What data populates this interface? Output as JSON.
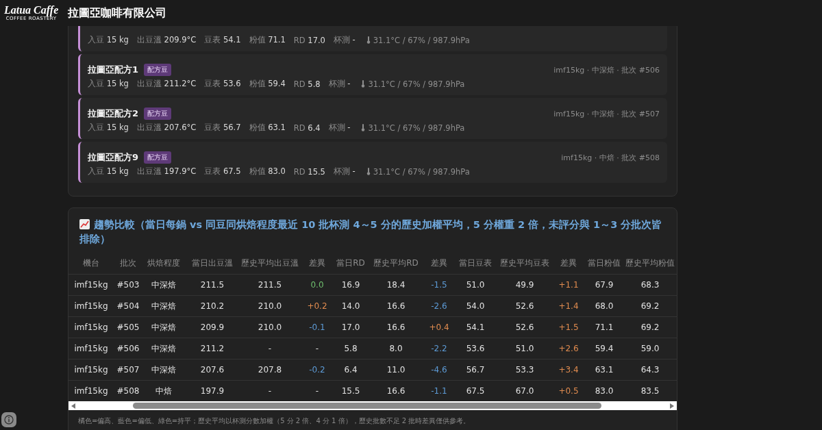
{
  "header": {
    "logo": "Latua Caffe",
    "logo_sub": "COFFEE ROASTERY",
    "title": "拉圖亞咖啡有限公司"
  },
  "batches": [
    {
      "stats": [
        {
          "label": "入豆",
          "value": "15 kg"
        },
        {
          "label": "出豆溫",
          "value": "209.9°C"
        },
        {
          "label": "豆表",
          "value": "54.1"
        },
        {
          "label": "粉值",
          "value": "71.1"
        },
        {
          "label": "RD",
          "value": "17.0"
        },
        {
          "label": "杯測",
          "value": "-"
        }
      ],
      "weather": "31.1°C / 67% / 987.9hPa"
    },
    {
      "name": "拉圖亞配方1",
      "tag": "配方豆",
      "meta": "imf15kg · 中深焙 · 批次 #506",
      "stats": [
        {
          "label": "入豆",
          "value": "15 kg"
        },
        {
          "label": "出豆溫",
          "value": "211.2°C"
        },
        {
          "label": "豆表",
          "value": "53.6"
        },
        {
          "label": "粉值",
          "value": "59.4"
        },
        {
          "label": "RD",
          "value": "5.8"
        },
        {
          "label": "杯測",
          "value": "-"
        }
      ],
      "weather": "31.1°C / 67% / 987.9hPa"
    },
    {
      "name": "拉圖亞配方2",
      "tag": "配方豆",
      "meta": "imf15kg · 中深焙 · 批次 #507",
      "stats": [
        {
          "label": "入豆",
          "value": "15 kg"
        },
        {
          "label": "出豆溫",
          "value": "207.6°C"
        },
        {
          "label": "豆表",
          "value": "56.7"
        },
        {
          "label": "粉值",
          "value": "63.1"
        },
        {
          "label": "RD",
          "value": "6.4"
        },
        {
          "label": "杯測",
          "value": "-"
        }
      ],
      "weather": "31.1°C / 67% / 987.9hPa"
    },
    {
      "name": "拉圖亞配方9",
      "tag": "配方豆",
      "meta": "imf15kg · 中焙 · 批次 #508",
      "stats": [
        {
          "label": "入豆",
          "value": "15 kg"
        },
        {
          "label": "出豆溫",
          "value": "197.9°C"
        },
        {
          "label": "豆表",
          "value": "67.5"
        },
        {
          "label": "粉值",
          "value": "83.0"
        },
        {
          "label": "RD",
          "value": "15.5"
        },
        {
          "label": "杯測",
          "value": "-"
        }
      ],
      "weather": "31.1°C / 67% / 987.9hPa"
    }
  ],
  "trend": {
    "title": "趨勢比較（當日每鍋 vs 同豆同烘焙程度最近 10 批杯測 4～5 分的歷史加權平均，5 分權重 2 倍，未評分與 1～3 分批次皆排除）",
    "columns": [
      "機台",
      "批次",
      "烘焙程度",
      "當日出豆溫",
      "歷史平均出豆溫",
      "差異",
      "當日RD",
      "歷史平均RD",
      "差異",
      "當日豆表",
      "歷史平均豆表",
      "差異",
      "當日粉值",
      "歷史平均粉值"
    ],
    "rows": [
      [
        {
          "text": "imf15kg"
        },
        {
          "text": "#503"
        },
        {
          "text": "中深焙"
        },
        {
          "text": "211.5"
        },
        {
          "text": "211.5"
        },
        {
          "text": "0.0",
          "color": "#6fbf6e"
        },
        {
          "text": "16.9"
        },
        {
          "text": "18.4"
        },
        {
          "text": "-1.5",
          "color": "#5d9bd6"
        },
        {
          "text": "51.0"
        },
        {
          "text": "49.9"
        },
        {
          "text": "+1.1",
          "color": "#e08b4f"
        },
        {
          "text": "67.9"
        },
        {
          "text": "68.3"
        }
      ],
      [
        {
          "text": "imf15kg"
        },
        {
          "text": "#504"
        },
        {
          "text": "中深焙"
        },
        {
          "text": "210.2"
        },
        {
          "text": "210.0"
        },
        {
          "text": "+0.2",
          "color": "#e08b4f"
        },
        {
          "text": "14.0"
        },
        {
          "text": "16.6"
        },
        {
          "text": "-2.6",
          "color": "#5d9bd6"
        },
        {
          "text": "54.0"
        },
        {
          "text": "52.6"
        },
        {
          "text": "+1.4",
          "color": "#e08b4f"
        },
        {
          "text": "68.0"
        },
        {
          "text": "69.2"
        }
      ],
      [
        {
          "text": "imf15kg"
        },
        {
          "text": "#505"
        },
        {
          "text": "中深焙"
        },
        {
          "text": "209.9"
        },
        {
          "text": "210.0"
        },
        {
          "text": "-0.1",
          "color": "#5d9bd6"
        },
        {
          "text": "17.0"
        },
        {
          "text": "16.6"
        },
        {
          "text": "+0.4",
          "color": "#e08b4f"
        },
        {
          "text": "54.1"
        },
        {
          "text": "52.6"
        },
        {
          "text": "+1.5",
          "color": "#e08b4f"
        },
        {
          "text": "71.1"
        },
        {
          "text": "69.2"
        }
      ],
      [
        {
          "text": "imf15kg"
        },
        {
          "text": "#506"
        },
        {
          "text": "中深焙"
        },
        {
          "text": "211.2"
        },
        {
          "text": "-"
        },
        {
          "text": "-"
        },
        {
          "text": "5.8"
        },
        {
          "text": "8.0"
        },
        {
          "text": "-2.2",
          "color": "#5d9bd6"
        },
        {
          "text": "53.6"
        },
        {
          "text": "51.0"
        },
        {
          "text": "+2.6",
          "color": "#e08b4f"
        },
        {
          "text": "59.4"
        },
        {
          "text": "59.0"
        }
      ],
      [
        {
          "text": "imf15kg"
        },
        {
          "text": "#507"
        },
        {
          "text": "中深焙"
        },
        {
          "text": "207.6"
        },
        {
          "text": "207.8"
        },
        {
          "text": "-0.2",
          "color": "#5d9bd6"
        },
        {
          "text": "6.4"
        },
        {
          "text": "11.0"
        },
        {
          "text": "-4.6",
          "color": "#5d9bd6"
        },
        {
          "text": "56.7"
        },
        {
          "text": "53.3"
        },
        {
          "text": "+3.4",
          "color": "#e08b4f"
        },
        {
          "text": "63.1"
        },
        {
          "text": "64.3"
        }
      ],
      [
        {
          "text": "imf15kg"
        },
        {
          "text": "#508"
        },
        {
          "text": "中焙"
        },
        {
          "text": "197.9"
        },
        {
          "text": "-"
        },
        {
          "text": "-"
        },
        {
          "text": "15.5"
        },
        {
          "text": "16.6"
        },
        {
          "text": "-1.1",
          "color": "#5d9bd6"
        },
        {
          "text": "67.5"
        },
        {
          "text": "67.0"
        },
        {
          "text": "+0.5",
          "color": "#e08b4f"
        },
        {
          "text": "83.0"
        },
        {
          "text": "83.5"
        }
      ]
    ],
    "note": "橘色=偏高、藍色=偏低、綠色=持平；歷史平均以杯測分數加權（5 分 2 倍、4 分 1 倍），歷史批數不足 2 批時差異僅供參考。"
  }
}
